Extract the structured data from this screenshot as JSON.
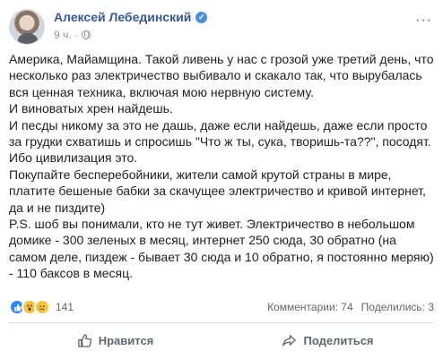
{
  "post": {
    "author": "Алексей Лебединский",
    "time": "9 ч.",
    "dot": "·",
    "more_label": "···",
    "lines": [
      "Америка, Майамщина. Такой ливень у нас с грозой уже третий день, что",
      "несколько раз электричество выбивало и скакало так, что вырубалась",
      "вся ценная техника, включая мою нервную систему.",
      "И виноватых хрен найдешь.",
      "И песды никому за это не дашь, даже если найдешь, даже если просто",
      "за грудки схватишь и спросишь \"Что ж ты, сука, творишь-та??\", посодят.",
      "Ибо цивилизация это.",
      "Покупайте бесперебойники, жители самой крутой страны в мире,",
      "платите бешеные бабки за скачущее электричество и кривой интернет,",
      "да и не пиздите)",
      "P.S. шоб вы понимали, кто не тут живет. Электричество в небольшом",
      "домике - 300 зеленых в месяц, интернет 250 сюда, 30 обратно (на",
      "самом деле, пиздеж - бывает 30 сюда и 10 обратно, я постоянно меряю)",
      "- 110 баксов в месяц."
    ]
  },
  "reactions": {
    "icons": [
      "like-icon",
      "wow-icon",
      "sad-icon"
    ],
    "count": "141",
    "comments": "Комментарии: 74",
    "shares": "Поделились: 3"
  },
  "actions": {
    "like_label": "Нравится",
    "share_label": "Поделиться"
  },
  "colors": {
    "author": "#385898",
    "meta": "#90949c",
    "like_blue": "#2d88ff",
    "emoji_yellow": "#f7c53d"
  }
}
